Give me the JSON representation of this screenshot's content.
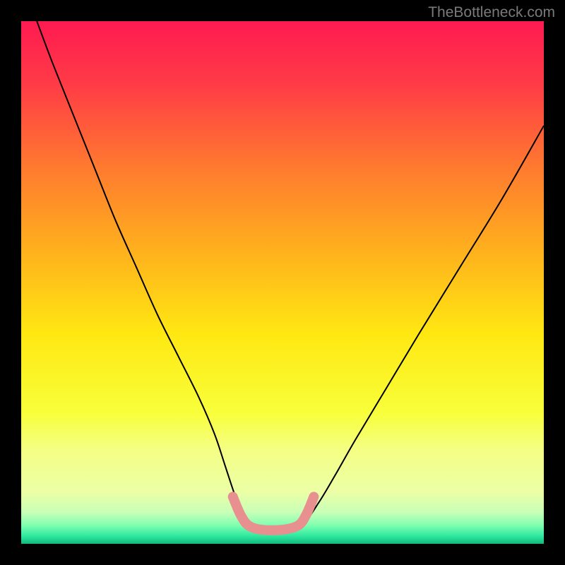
{
  "watermark": "TheBottleneck.com",
  "chart_data": {
    "type": "line",
    "title": "",
    "xlabel": "",
    "ylabel": "",
    "xlim": [
      0,
      100
    ],
    "ylim": [
      0,
      100
    ],
    "grid": false,
    "background_gradient": {
      "stops": [
        {
          "offset": 0.0,
          "color": "#ff1a52"
        },
        {
          "offset": 0.12,
          "color": "#ff3b46"
        },
        {
          "offset": 0.28,
          "color": "#ff7a2f"
        },
        {
          "offset": 0.45,
          "color": "#ffb41c"
        },
        {
          "offset": 0.6,
          "color": "#ffe812"
        },
        {
          "offset": 0.75,
          "color": "#f8ff3a"
        },
        {
          "offset": 0.82,
          "color": "#f4ff84"
        },
        {
          "offset": 0.9,
          "color": "#ecffa5"
        },
        {
          "offset": 0.94,
          "color": "#c8ffb8"
        },
        {
          "offset": 0.965,
          "color": "#7dffb0"
        },
        {
          "offset": 0.985,
          "color": "#2fe9a0"
        },
        {
          "offset": 1.0,
          "color": "#0fb97a"
        }
      ]
    },
    "series": [
      {
        "name": "bottleneck-curve",
        "color": "#000000",
        "width": 2,
        "x": [
          3,
          6,
          10,
          14,
          18,
          22,
          26,
          30,
          34,
          37,
          39,
          41,
          43,
          46,
          50,
          54,
          57,
          60,
          64,
          70,
          76,
          84,
          92,
          100
        ],
        "y": [
          100,
          92,
          82,
          72,
          62,
          53,
          44,
          36,
          28,
          21,
          15,
          9,
          4,
          2.5,
          2.5,
          4,
          8,
          13,
          20,
          30,
          40,
          53,
          66,
          80
        ]
      },
      {
        "name": "optimal-range-marker",
        "color": "#e88f8f",
        "width": 14,
        "cap": "round",
        "x": [
          40.5,
          42,
          43.5,
          46,
          50,
          53,
          54.5,
          56
        ],
        "y": [
          9,
          5.5,
          3.5,
          2.7,
          2.7,
          3.5,
          5.5,
          9
        ]
      }
    ]
  }
}
